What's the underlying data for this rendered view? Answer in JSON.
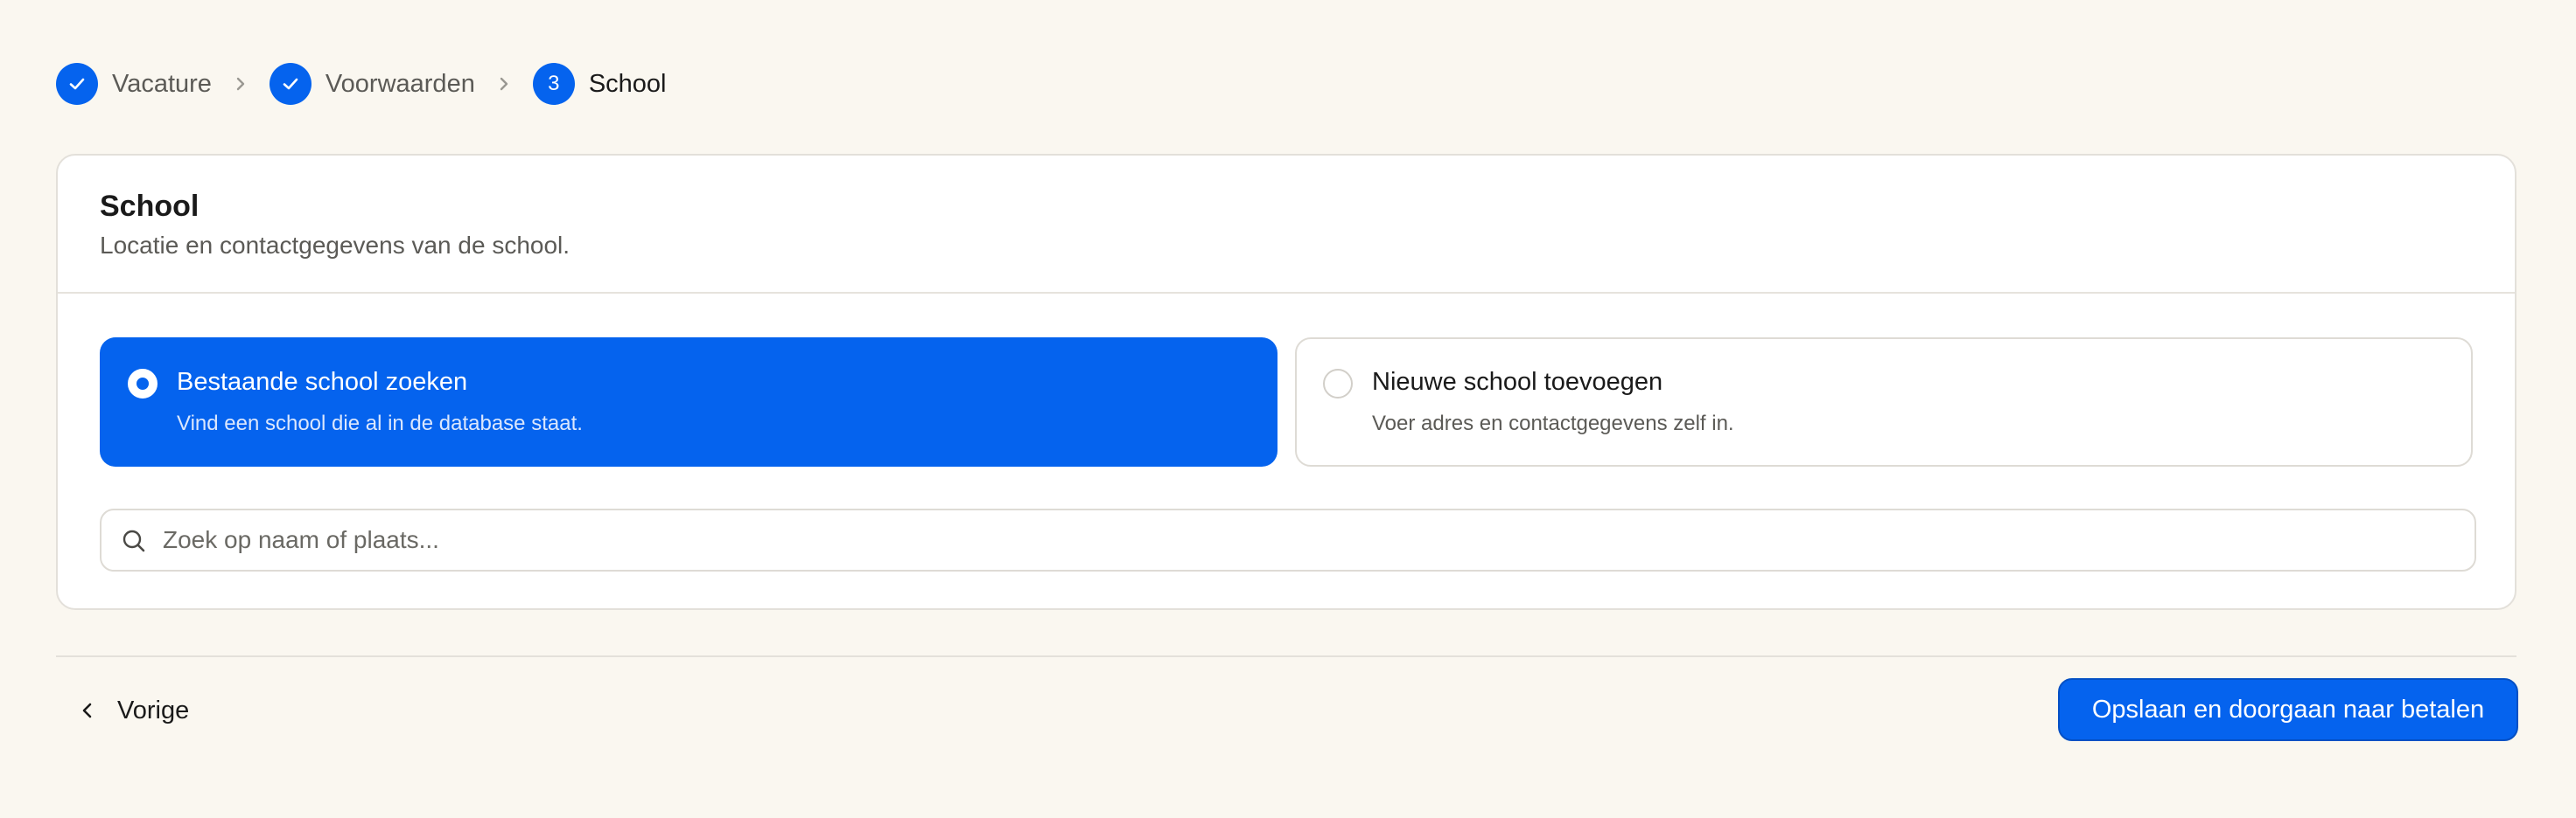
{
  "stepper": {
    "steps": [
      {
        "label": "Vacature",
        "state": "completed",
        "icon": "check-icon"
      },
      {
        "label": "Voorwaarden",
        "state": "completed",
        "icon": "check-icon"
      },
      {
        "label": "School",
        "state": "current",
        "number": "3"
      }
    ],
    "separator_icon": "chevron-right-icon"
  },
  "card": {
    "title": "School",
    "subtitle": "Locatie en contactgegevens van de school.",
    "options": [
      {
        "title": "Bestaande school zoeken",
        "description": "Vind een school die al in de database staat.",
        "selected": true
      },
      {
        "title": "Nieuwe school toevoegen",
        "description": "Voer adres en contactgegevens zelf in.",
        "selected": false
      }
    ],
    "search": {
      "placeholder": "Zoek op naam of plaats...",
      "value": "",
      "icon": "search-icon"
    }
  },
  "footer": {
    "back_label": "Vorige",
    "back_icon": "chevron-left-icon",
    "primary_label": "Opslaan en doorgaan naar betalen"
  },
  "colors": {
    "accent": "#0563ee",
    "background": "#faf7f0",
    "card": "#ffffff",
    "muted_text": "#5b5a56"
  }
}
